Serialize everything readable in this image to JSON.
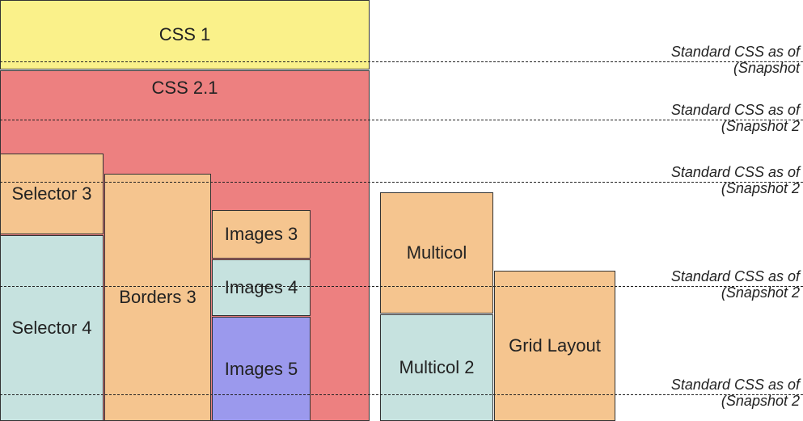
{
  "blocks": {
    "css1": "CSS 1",
    "css21": "CSS 2.1",
    "selector3": "Selector 3",
    "selector4": "Selector 4",
    "borders3": "Borders 3",
    "images3": "Images 3",
    "images4": "Images 4",
    "images5": "Images 5",
    "multicol": "Multicol",
    "multicol2": "Multicol 2",
    "gridlayout": "Grid Layout"
  },
  "dividers": {
    "d1_line1": "Standard CSS as of",
    "d1_line2": "(Snapshot",
    "d2_line1": "Standard CSS as of",
    "d2_line2": "(Snapshot 2",
    "d3_line1": "Standard CSS as of",
    "d3_line2": "(Snapshot 2",
    "d4_line1": "Standard CSS as of",
    "d4_line2": "(Snapshot 2",
    "d5_line1": "Standard CSS as of",
    "d5_line2": "(Snapshot 2"
  }
}
